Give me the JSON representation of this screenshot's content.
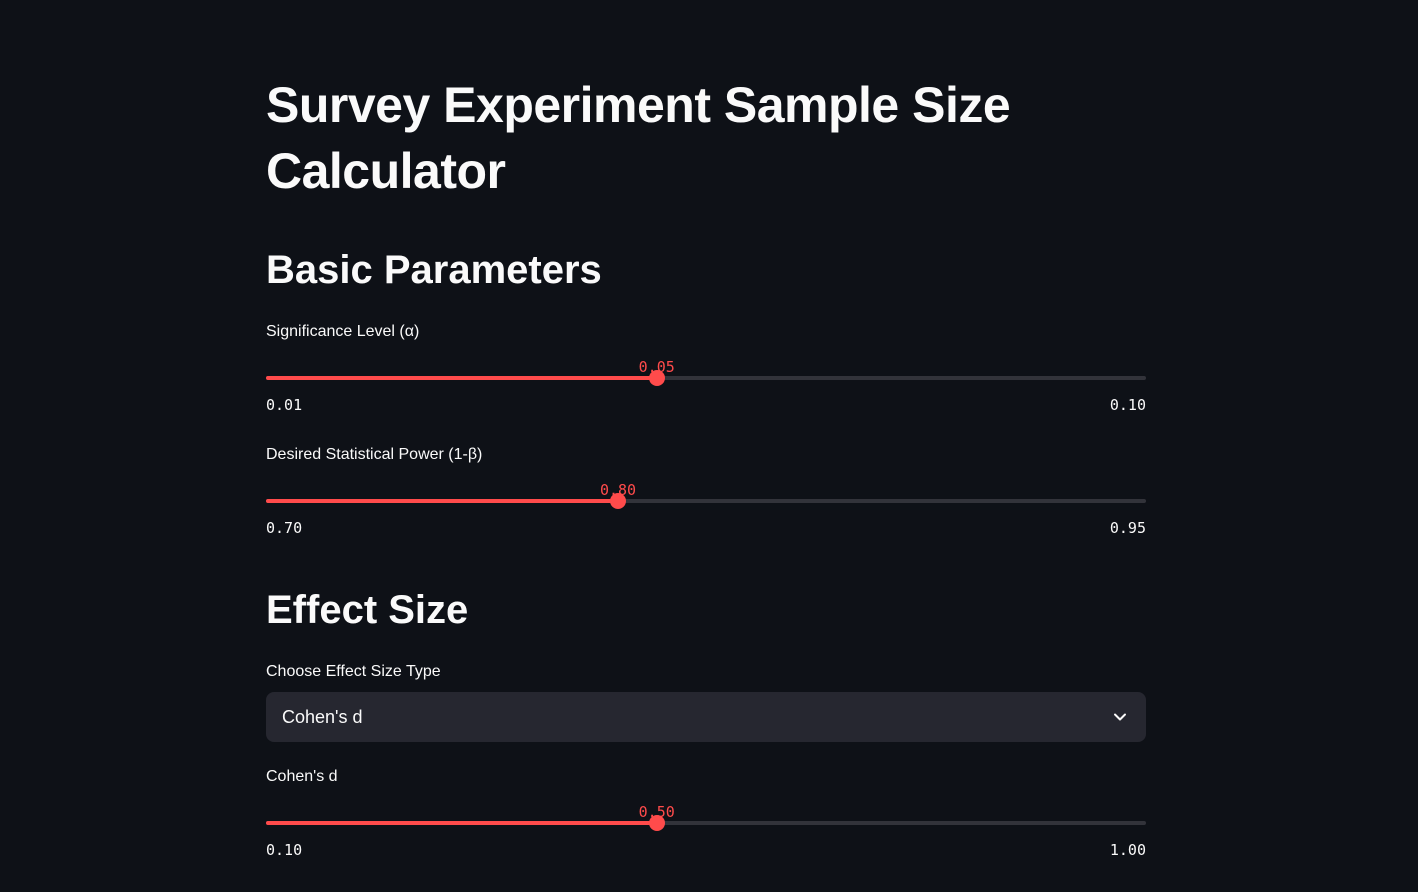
{
  "title": "Survey Experiment Sample Size Calculator",
  "sections": {
    "basic": "Basic Parameters",
    "effect": "Effect Size"
  },
  "sliders": {
    "alpha": {
      "label": "Significance Level (α)",
      "value": "0.05",
      "min": "0.01",
      "max": "0.10",
      "fraction": 0.444
    },
    "power": {
      "label": "Desired Statistical Power (1-β)",
      "value": "0.80",
      "min": "0.70",
      "max": "0.95",
      "fraction": 0.4
    },
    "cohen": {
      "label": "Cohen's d",
      "value": "0.50",
      "min": "0.10",
      "max": "1.00",
      "fraction": 0.444
    }
  },
  "effect_select": {
    "label": "Choose Effect Size Type",
    "value": "Cohen's d",
    "icon": "chevron-down-icon"
  },
  "colors": {
    "background": "#0e1117",
    "accent": "#ff4b4b",
    "track": "#32333a",
    "select_bg": "#262730",
    "text": "#fafafa"
  }
}
